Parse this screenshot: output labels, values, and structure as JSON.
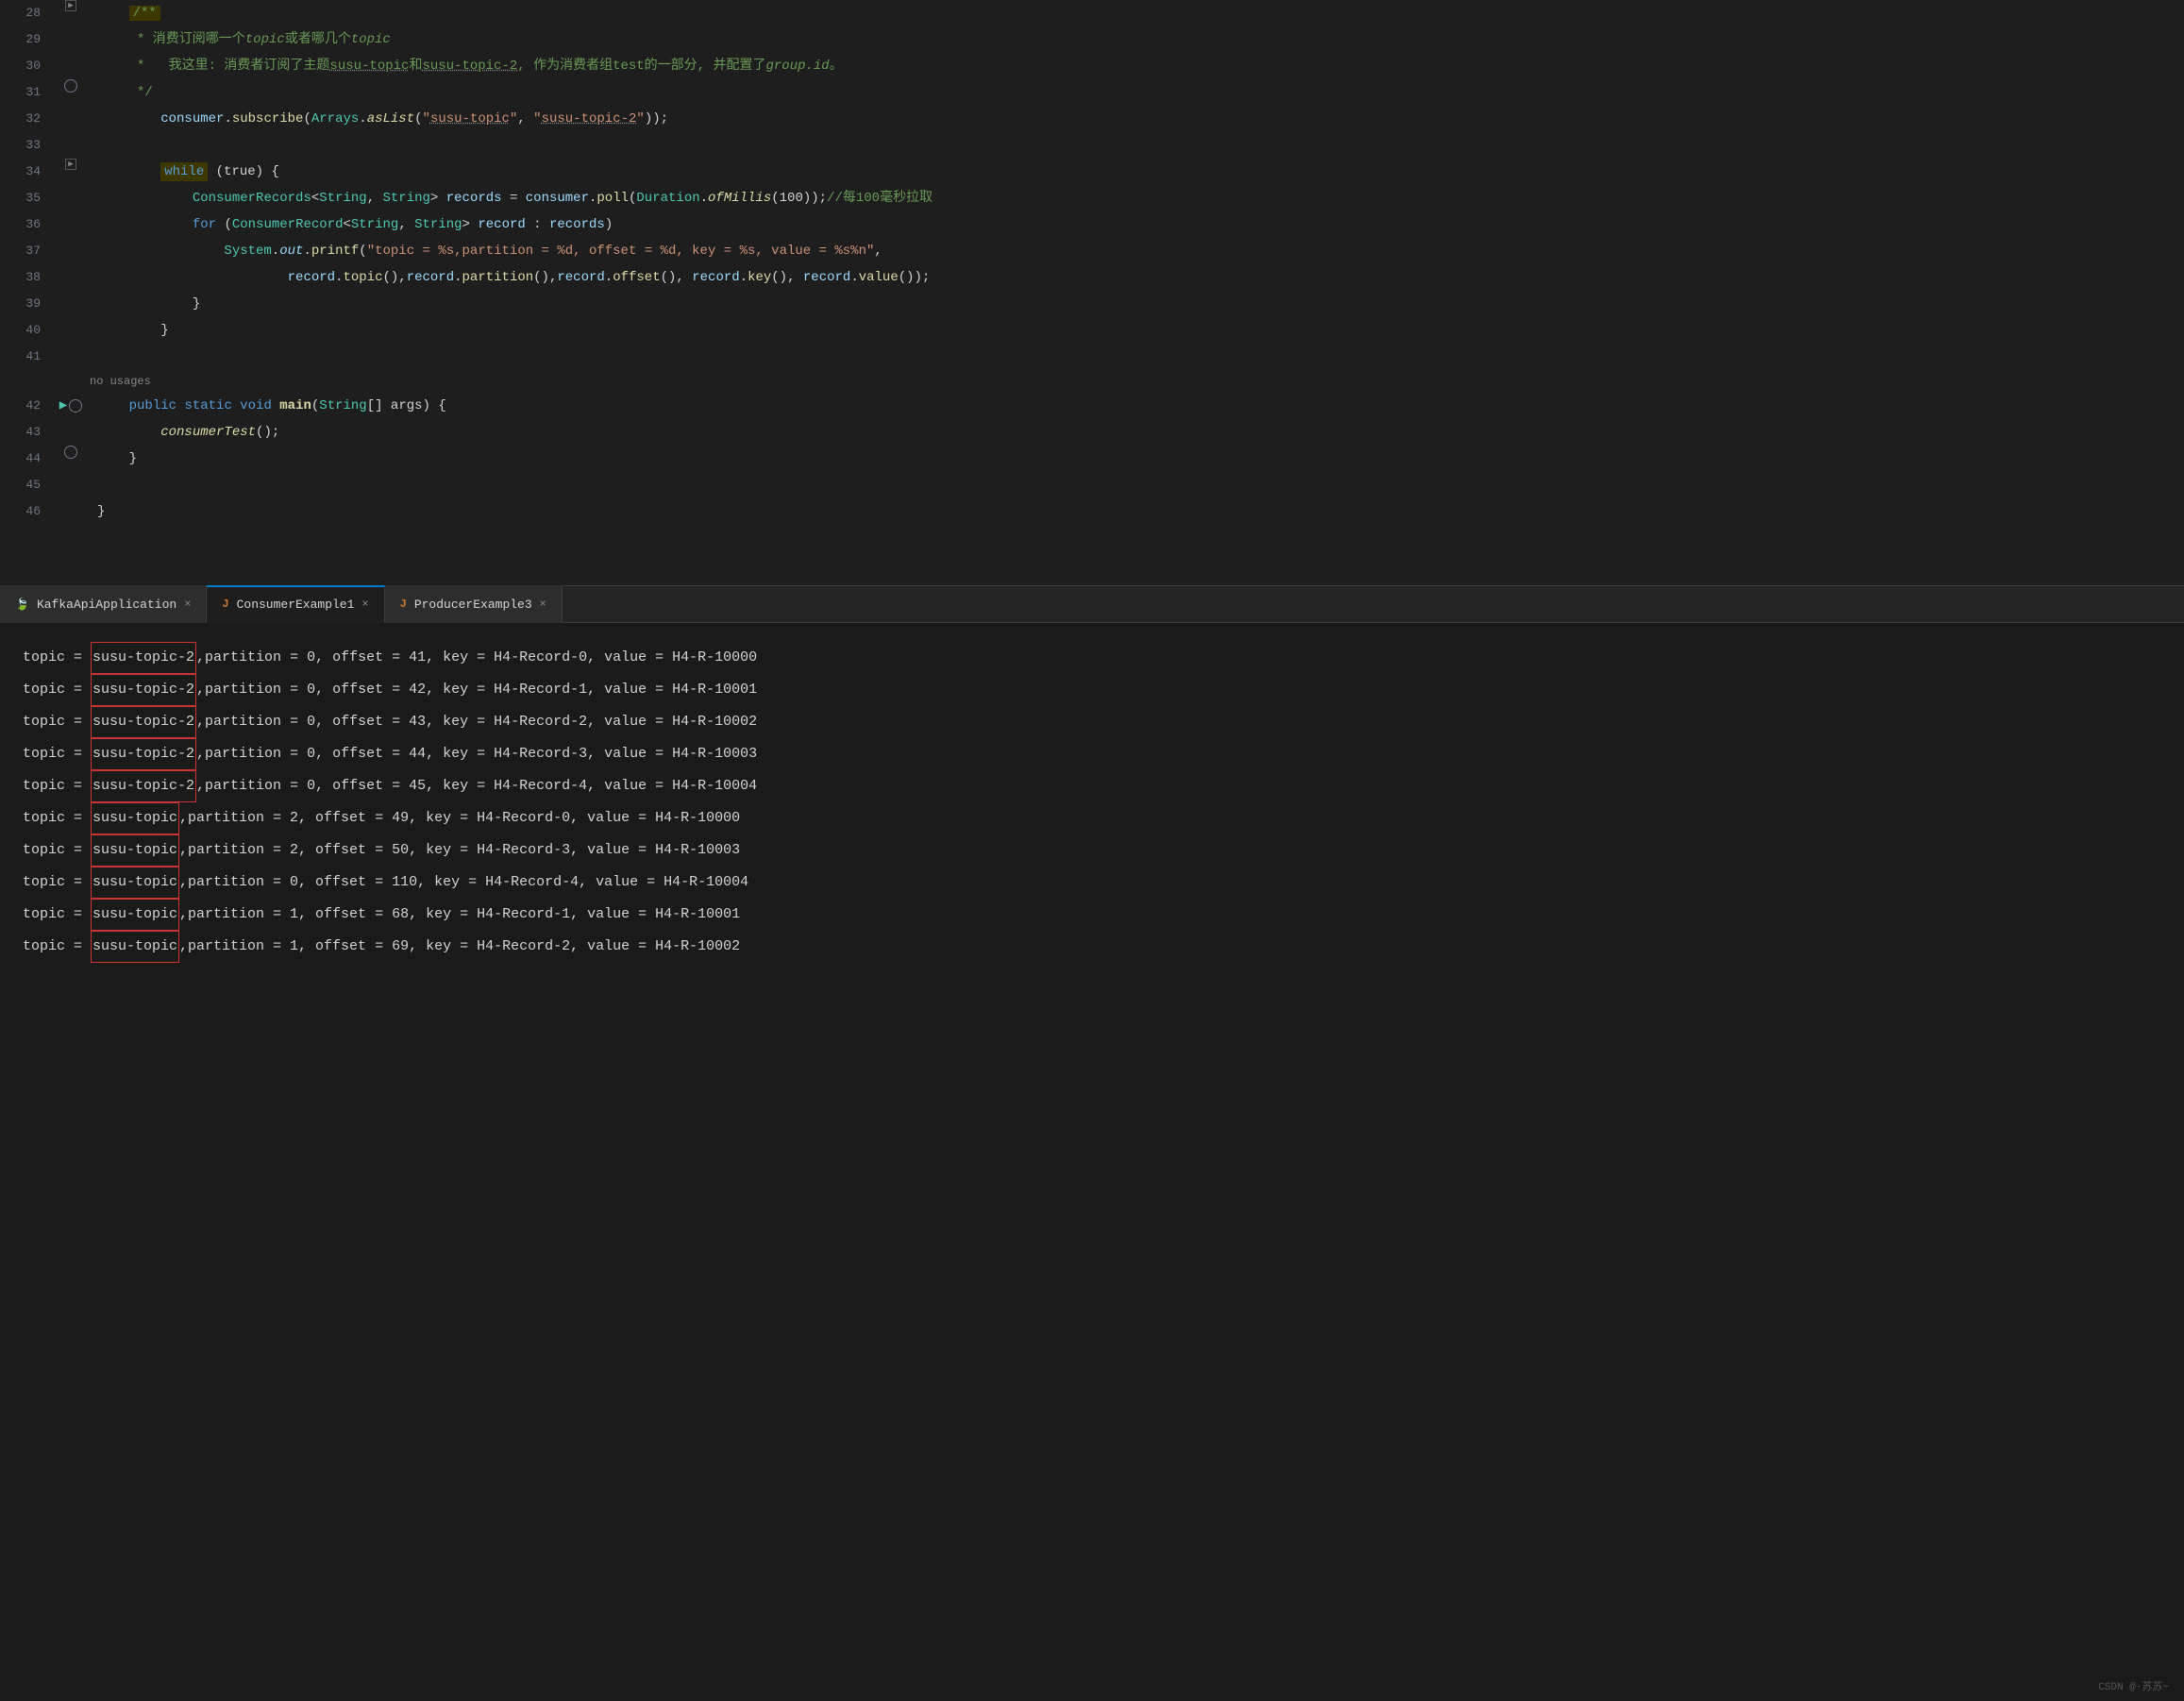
{
  "editor": {
    "lines": [
      {
        "num": "28",
        "gutter": "fold",
        "content": ""
      },
      {
        "num": "29",
        "gutter": "",
        "type": "comment",
        "content": " * 消费订阅哪一个topic或者哪几个topic"
      },
      {
        "num": "30",
        "gutter": "",
        "type": "comment",
        "content": " *   我这里: 消费者订阅了主题susu-topic和susu-topic-2, 作为消费者组test的一部分, 并配置了group.id。"
      },
      {
        "num": "31",
        "gutter": "",
        "type": "comment",
        "content": " */"
      },
      {
        "num": "32",
        "gutter": "",
        "type": "code",
        "content": "consumer.subscribe(Arrays.asList(\"susu-topic\", \"susu-topic-2\"));"
      },
      {
        "num": "33",
        "gutter": "",
        "type": "empty",
        "content": ""
      },
      {
        "num": "34",
        "gutter": "fold",
        "type": "code",
        "content": "while (true) {"
      },
      {
        "num": "35",
        "gutter": "",
        "type": "code",
        "content": "    ConsumerRecords<String, String> records = consumer.poll(Duration.ofMillis(100));//每100毫秒拉取"
      },
      {
        "num": "36",
        "gutter": "",
        "type": "code",
        "content": "    for (ConsumerRecord<String, String> record : records)"
      },
      {
        "num": "37",
        "gutter": "",
        "type": "code",
        "content": "        System.out.printf(\"topic = %s,partition = %d, offset = %d, key = %s, value = %s%n\","
      },
      {
        "num": "38",
        "gutter": "",
        "type": "code",
        "content": "                record.topic(),record.partition(),record.offset(), record.key(), record.value());"
      },
      {
        "num": "39",
        "gutter": "",
        "type": "code",
        "content": "    }"
      },
      {
        "num": "40",
        "gutter": "",
        "type": "code",
        "content": "}"
      },
      {
        "num": "41",
        "gutter": "",
        "type": "empty",
        "content": ""
      }
    ],
    "no_usages": "no usages",
    "main_line_num": "42",
    "main_content": "public static void main(String[] args) {",
    "line43_num": "43",
    "line43_content": "    consumerTest();",
    "line44_num": "44",
    "line44_content": "}",
    "line45_num": "45",
    "line46_num": "46",
    "line46_content": "}"
  },
  "tabs": [
    {
      "name": "KafkaApiApplication",
      "type": "spring",
      "active": false
    },
    {
      "name": "ConsumerExample1",
      "type": "java",
      "active": true
    },
    {
      "name": "ProducerExample3",
      "type": "java",
      "active": false
    }
  ],
  "console": {
    "lines": [
      {
        "prefix": "topic = ",
        "topic": "susu-topic-2",
        "suffix": ",partition = 0, offset = 41, key = H4-Record-0, value = H4-R-10000"
      },
      {
        "prefix": "topic = ",
        "topic": "susu-topic-2",
        "suffix": ",partition = 0, offset = 42, key = H4-Record-1, value = H4-R-10001"
      },
      {
        "prefix": "topic = ",
        "topic": "susu-topic-2",
        "suffix": ",partition = 0, offset = 43, key = H4-Record-2, value = H4-R-10002"
      },
      {
        "prefix": "topic = ",
        "topic": "susu-topic-2",
        "suffix": ",partition = 0, offset = 44, key = H4-Record-3, value = H4-R-10003"
      },
      {
        "prefix": "topic = ",
        "topic": "susu-topic-2",
        "suffix": ",partition = 0, offset = 45, key = H4-Record-4, value = H4-R-10004"
      },
      {
        "prefix": "topic = ",
        "topic": "susu-topic",
        "suffix": ",partition = 2, offset = 49, key = H4-Record-0, value = H4-R-10000"
      },
      {
        "prefix": "topic = ",
        "topic": "susu-topic",
        "suffix": ",partition = 2, offset = 50, key = H4-Record-3, value = H4-R-10003"
      },
      {
        "prefix": "topic = ",
        "topic": "susu-topic",
        "suffix": ",partition = 0, offset = 110, key = H4-Record-4, value = H4-R-10004"
      },
      {
        "prefix": "topic = ",
        "topic": "susu-topic",
        "suffix": ",partition = 1, offset = 68, key = H4-Record-1, value = H4-R-10001"
      },
      {
        "prefix": "topic = ",
        "topic": "susu-topic",
        "suffix": ",partition = 1, offset = 69, key = H4-Record-2, value = H4-R-10002"
      }
    ]
  },
  "watermark": "CSDN @·苏苏~"
}
